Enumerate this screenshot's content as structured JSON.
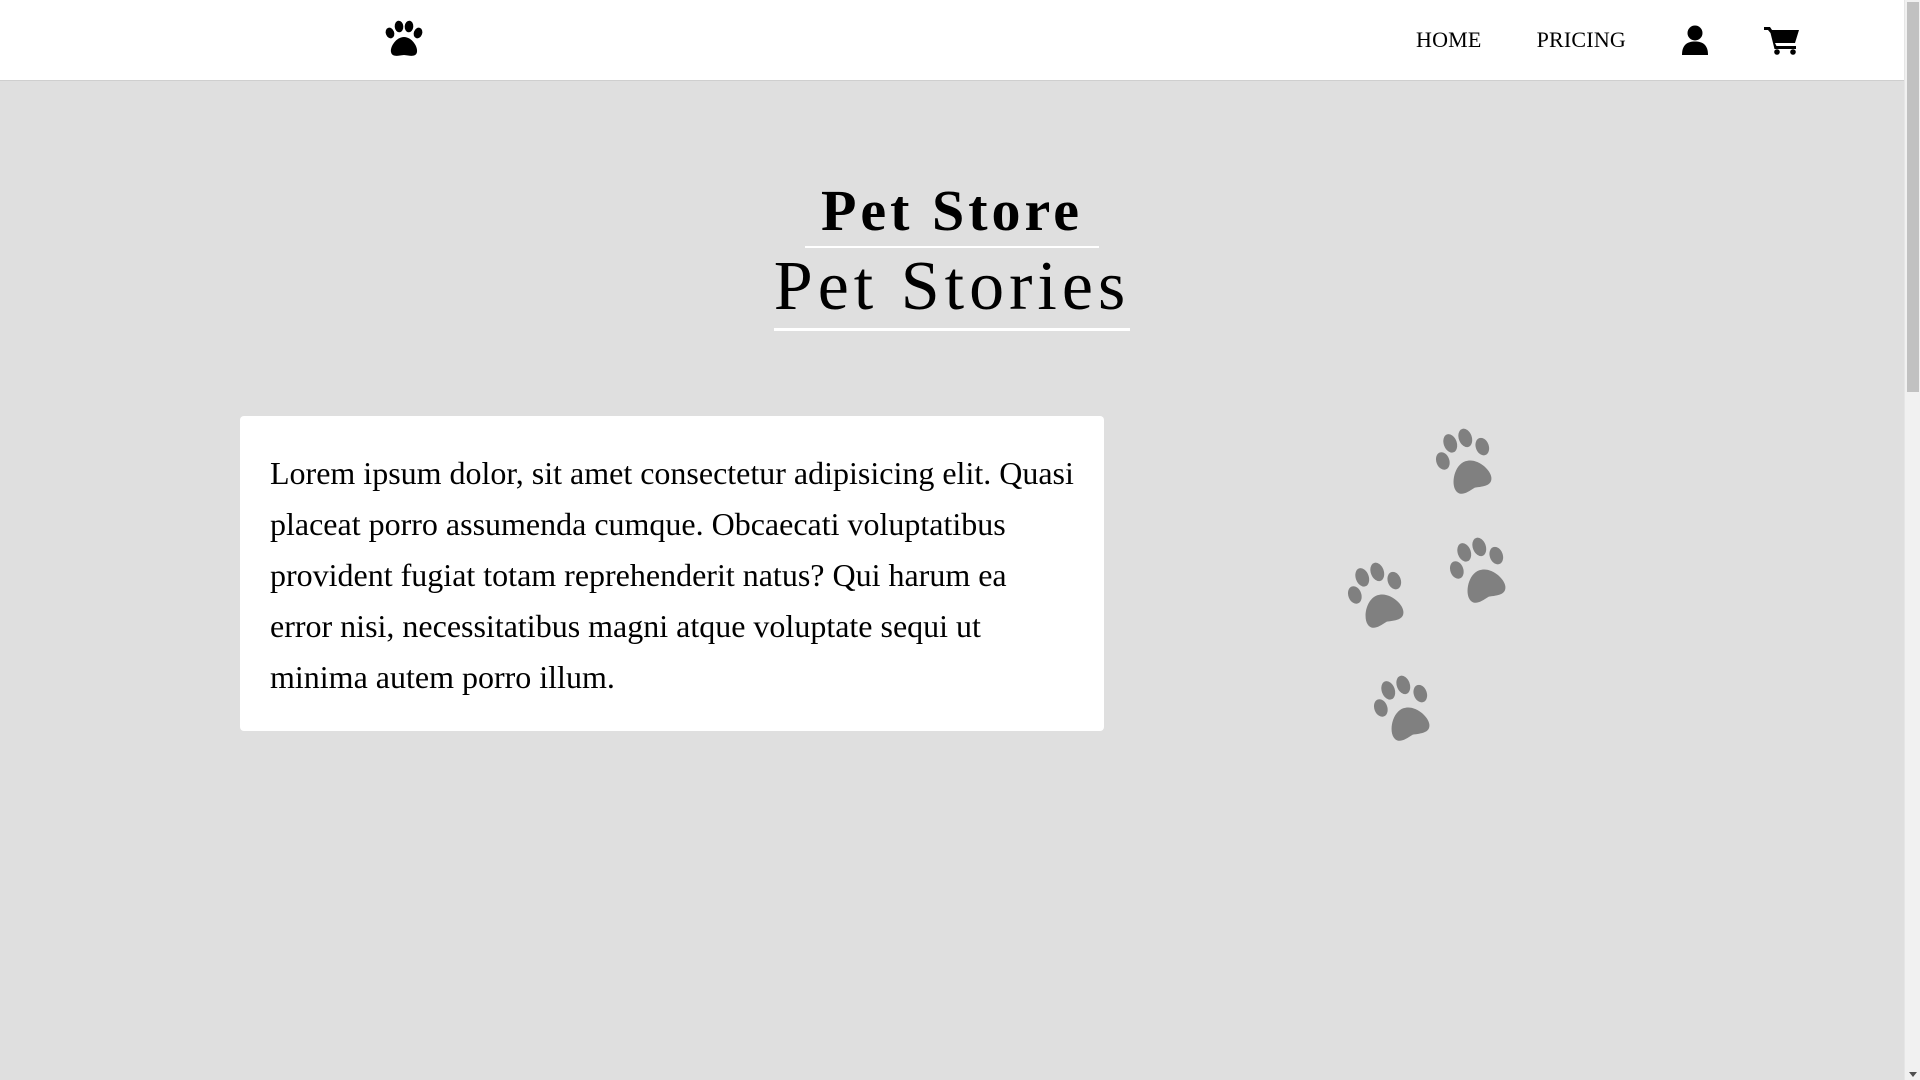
{
  "nav": {
    "logo_icon": "paw-icon",
    "links": [
      {
        "label": "HOME"
      },
      {
        "label": "PRICING"
      }
    ],
    "user_icon": "user-icon",
    "cart_icon": "cart-icon"
  },
  "hero": {
    "title_small": "Pet Store",
    "title_large": "Pet Stories"
  },
  "card": {
    "text": "Lorem ipsum dolor, sit amet consectetur adipisicing elit. Quasi placeat porro assumenda cumque. Obcaecati voluptatibus provident fugiat totam reprehenderit natus? Qui harum ea error nisi, necessitatibus magni atque voluptate sequi ut minima autem porro illum."
  },
  "decor": {
    "paw_icon": "paw-print-icon",
    "paw_count": 4,
    "paw_color": "#808080"
  },
  "colors": {
    "background": "#dfdfdf",
    "navbar": "#ffffff",
    "card": "#ffffff",
    "text": "#000000"
  }
}
